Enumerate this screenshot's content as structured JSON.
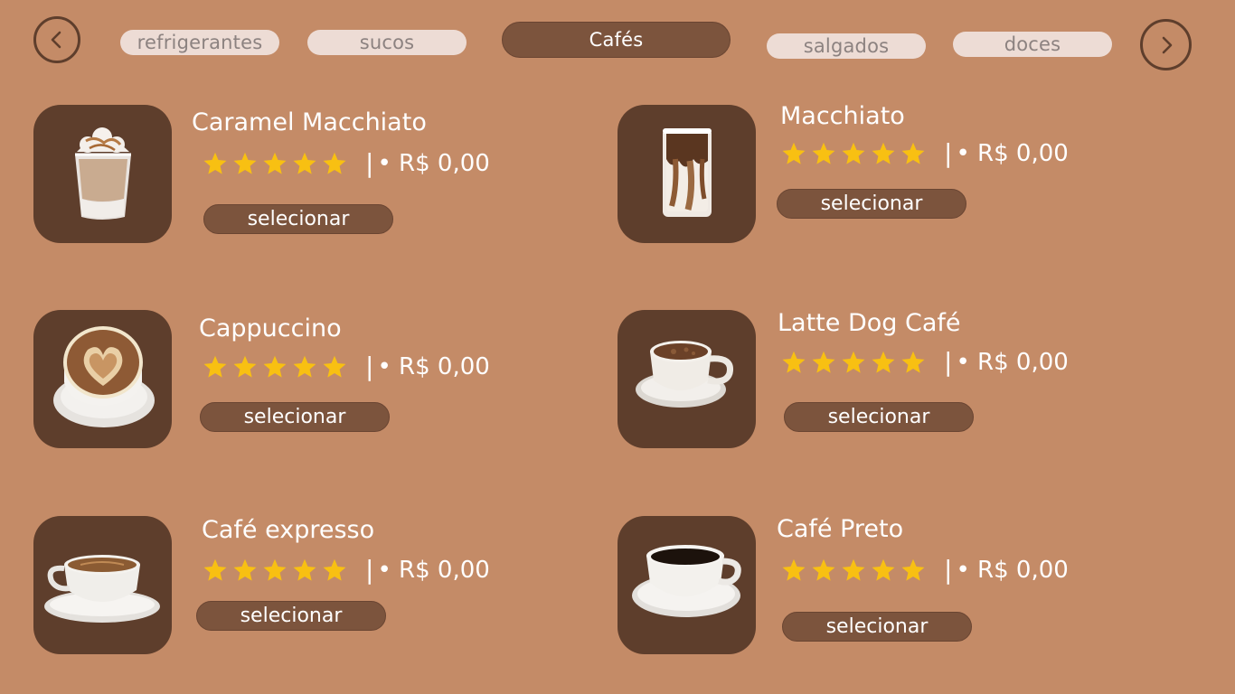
{
  "colors": {
    "background": "#c48b67",
    "card": "#5e3e2c",
    "active_tab": "#7c543d",
    "inactive_tab": "#eddcd5",
    "inactive_tab_text": "#8c8280",
    "star": "#f8c012",
    "text": "#ffffff"
  },
  "nav": {
    "prev_icon": "chevron-left-icon",
    "next_icon": "chevron-right-icon"
  },
  "categories": [
    {
      "label": "refrigerantes",
      "active": false
    },
    {
      "label": "sucos",
      "active": false
    },
    {
      "label": "Cafés",
      "active": true
    },
    {
      "label": "salgados",
      "active": false
    },
    {
      "label": "doces",
      "active": false
    }
  ],
  "products": [
    {
      "name": "Caramel Macchiato",
      "rating": 5,
      "separator": "|",
      "price": "• R$ 0,00",
      "button": "selecionar",
      "image": "iced-caramel-macchiato-image"
    },
    {
      "name": "Macchiato",
      "rating": 5,
      "separator": "|",
      "price": "• R$ 0,00",
      "button": "selecionar",
      "image": "iced-macchiato-glass-image"
    },
    {
      "name": "Cappuccino",
      "rating": 5,
      "separator": "|",
      "price": "• R$ 0,00",
      "button": "selecionar",
      "image": "cappuccino-latte-art-image"
    },
    {
      "name": "Latte Dog Café",
      "rating": 5,
      "separator": "|",
      "price": "• R$ 0,00",
      "button": "selecionar",
      "image": "latte-cup-saucer-image"
    },
    {
      "name": "Café expresso",
      "rating": 5,
      "separator": "|",
      "price": "• R$ 0,00",
      "button": "selecionar",
      "image": "espresso-cup-saucer-image"
    },
    {
      "name": "Café Preto",
      "rating": 5,
      "separator": "|",
      "price": "• R$ 0,00",
      "button": "selecionar",
      "image": "black-coffee-cup-image"
    }
  ]
}
